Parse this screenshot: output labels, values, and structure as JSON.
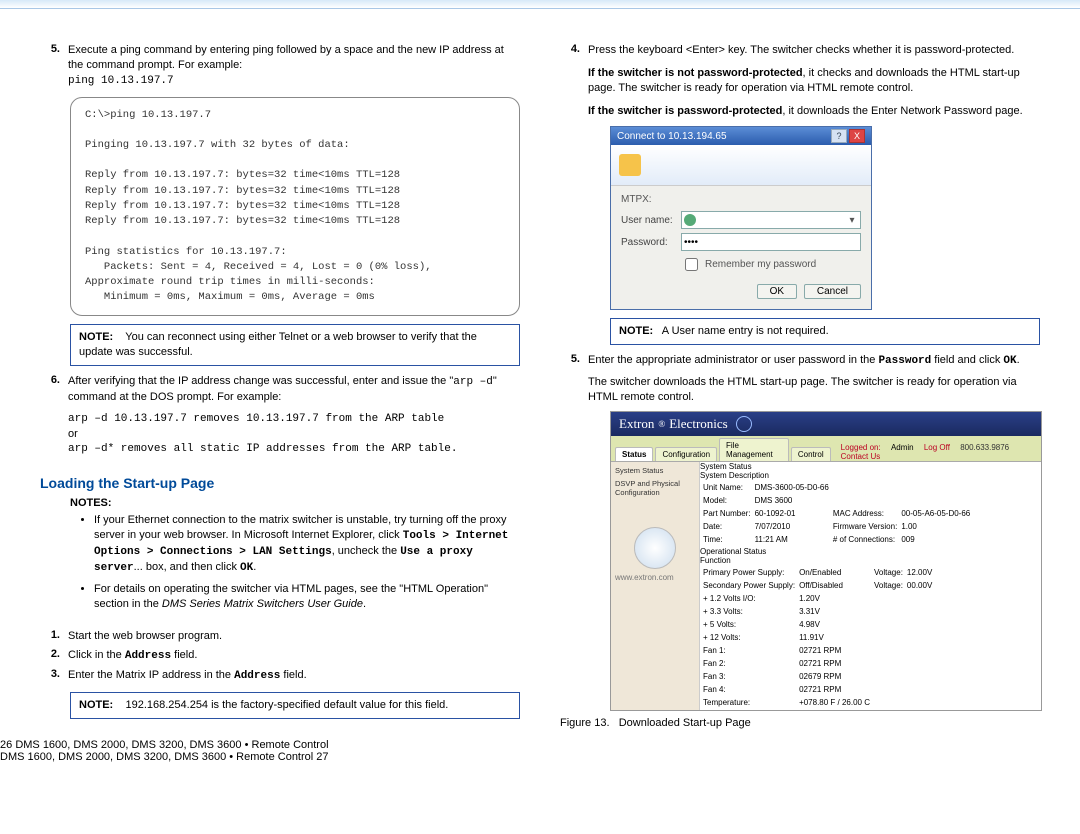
{
  "left": {
    "step5": {
      "num": "5.",
      "text_a": "Execute a ping command by entering ping followed by a space and the new IP address at the command prompt. For example:",
      "cmd": "ping 10.13.197.7"
    },
    "terminal": "C:\\>ping 10.13.197.7\n\nPinging 10.13.197.7 with 32 bytes of data:\n\nReply from 10.13.197.7: bytes=32 time<10ms TTL=128\nReply from 10.13.197.7: bytes=32 time<10ms TTL=128\nReply from 10.13.197.7: bytes=32 time<10ms TTL=128\nReply from 10.13.197.7: bytes=32 time<10ms TTL=128\n\nPing statistics for 10.13.197.7:\n   Packets: Sent = 4, Received = 4, Lost = 0 (0% loss),\nApproximate round trip times in milli-seconds:\n   Minimum = 0ms, Maximum = 0ms, Average = 0ms",
    "note1": {
      "label": "NOTE:",
      "text": "You can reconnect using either Telnet or a web browser to verify that the update was successful."
    },
    "step6": {
      "num": "6.",
      "text_a": "After verifying that the IP address change was successful, enter and issue the \"",
      "cmd_a": "arp –d",
      "text_b": "\" command at the DOS prompt. For example:",
      "line2": "arp –d 10.13.197.7 removes 10.13.197.7 from the ARP table",
      "or": "or",
      "line3": "arp –d* removes all static IP addresses from the ARP table."
    },
    "section": "Loading the Start-up Page",
    "notes": {
      "label": "NOTES:",
      "b1_a": "If your Ethernet connection to the matrix switcher is unstable, try turning off the proxy server in your web browser. In Microsoft Internet Explorer, click ",
      "b1_tools": "Tools",
      "b1_gt1": " > ",
      "b1_io": "Internet Options",
      "b1_gt2": " > ",
      "b1_conn": "Connections",
      "b1_gt3": " > ",
      "b1_lan": "LAN Settings",
      "b1_unc": ", uncheck the ",
      "b1_proxy": "Use a proxy server",
      "b1_box": "... box, and then click ",
      "b1_ok": "OK",
      "b1_end": ".",
      "b2_a": "For details on operating the switcher via HTML pages, see the \"HTML Operation\" section in the ",
      "b2_guide": "DMS Series Matrix Switchers User Guide",
      "b2_end": "."
    },
    "steps123": {
      "s1": {
        "num": "1.",
        "text": "Start the web browser program."
      },
      "s2": {
        "num": "2.",
        "text_a": "Click in the ",
        "bold": "Address",
        "text_b": " field."
      },
      "s3": {
        "num": "3.",
        "text_a": "Enter the Matrix IP address in the ",
        "bold": "Address",
        "text_b": " field."
      }
    },
    "note2": {
      "label": "NOTE:",
      "text": "192.168.254.254 is the factory-specified default value for this field."
    }
  },
  "right": {
    "step4": {
      "num": "4.",
      "text": "Press the keyboard <Enter> key. The switcher checks whether it is password-protected.",
      "p2_bold": "If the switcher is not password-protected",
      "p2_rest": ", it checks and downloads the HTML start-up page. The switcher is ready for operation via HTML remote control.",
      "p3_bold": "If the switcher is password-protected",
      "p3_rest": ", it downloads the Enter Network Password page."
    },
    "dialog": {
      "title": "Connect to 10.13.194.65",
      "server": "MTPX:",
      "user_lbl": "User name:",
      "user_val": "",
      "pass_lbl": "Password:",
      "pass_val": "••••",
      "remember": "Remember my password",
      "ok": "OK",
      "cancel": "Cancel"
    },
    "note3": {
      "label": "NOTE:",
      "text": "A User name entry is not required."
    },
    "step5r": {
      "num": "5.",
      "text_a": "Enter the appropriate administrator or user password in the ",
      "pw": "Password",
      "text_b": " field and click ",
      "ok": "OK",
      "text_c": ".",
      "p2": "The switcher downloads the HTML start-up page. The switcher is ready for operation via HTML remote control."
    },
    "extron": {
      "brand_a": "Extron",
      "brand_b": "Electronics",
      "tabs": [
        "Status",
        "Configuration",
        "File Management",
        "Control"
      ],
      "loggedon_lbl": "Logged on:",
      "loggedon_val": "Admin",
      "logoff": "Log Off",
      "ip": "800.633.9876",
      "contact": "Contact Us",
      "side_links": [
        "System Status",
        "DSVP and Physical Configuration"
      ],
      "side_url": "www.extron.com",
      "title": "System Status",
      "sysinfo_hdr": "System Description",
      "info": {
        "unit_lbl": "Unit Name:",
        "unit": "DMS-3600-05-D0-66",
        "model_lbl": "Model:",
        "model": "DMS 3600",
        "part_lbl": "Part Number:",
        "part": "60-1092-01",
        "mac_lbl": "MAC Address:",
        "mac": "00-05-A6-05-D0-66",
        "date_lbl": "Date:",
        "date": "7/07/2010",
        "fw_lbl": "Firmware Version:",
        "fw": "1.00",
        "time_lbl": "Time:",
        "time": "11:21 AM",
        "conn_lbl": "# of Connections:",
        "conn": "009"
      },
      "op_hdr": "Operational Status",
      "func_lbl": "Function",
      "rows": [
        [
          "Primary Power Supply:",
          "On/Enabled",
          "Voltage:",
          "12.00V"
        ],
        [
          "Secondary Power Supply:",
          "Off/Disabled",
          "Voltage:",
          "00.00V"
        ],
        [
          "+ 1.2 Volts I/O:",
          "1.20V",
          "",
          ""
        ],
        [
          "+ 3.3 Volts:",
          "3.31V",
          "",
          ""
        ],
        [
          "+ 5 Volts:",
          "4.98V",
          "",
          ""
        ],
        [
          "+ 12 Volts:",
          "11.91V",
          "",
          ""
        ],
        [
          "Fan 1:",
          "02721 RPM",
          "",
          ""
        ],
        [
          "Fan 2:",
          "02721 RPM",
          "",
          ""
        ],
        [
          "Fan 3:",
          "02679 RPM",
          "",
          ""
        ],
        [
          "Fan 4:",
          "02721 RPM",
          "",
          ""
        ],
        [
          "Temperature:",
          "+078.80 F / 26.00 C",
          "",
          ""
        ]
      ]
    },
    "fig": {
      "label": "Figure 13.",
      "text": "Downloaded Start-up Page"
    }
  },
  "footer": {
    "left_num": "26",
    "left_text_b": "DMS 1600, DMS 2000, DMS 3200, DMS 3600 • Remote Control",
    "right_text_b": "DMS 1600, DMS 2000, DMS 3200, DMS 3600 • Remote Control",
    "right_num": "27"
  }
}
